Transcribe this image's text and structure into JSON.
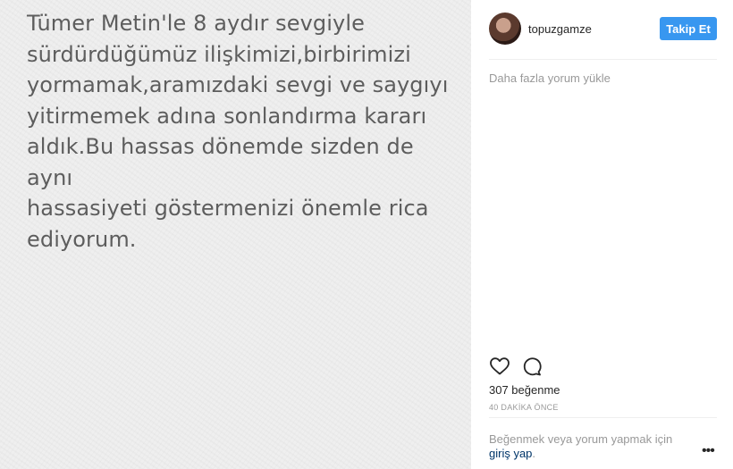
{
  "post": {
    "image_text": "Tümer Metin'le 8 aydır sevgiyle\nsürdürdüğümüz ilişkimizi,birbirimizi\nyormamak,aramızdaki sevgi ve saygıyı\nyitirmemek adına sonlandırma kararı\naldık.Bu hassas dönemde sizden de aynı\nhassasiyeti göstermenizi önemle rica\nediyorum."
  },
  "header": {
    "username": "topuzgamze",
    "follow_label": "Takip Et"
  },
  "comments": {
    "load_more_label": "Daha fazla yorum yükle"
  },
  "actions": {
    "like_icon": "heart-outline",
    "comment_icon": "speech-bubble-outline"
  },
  "stats": {
    "likes": "307 beğenme",
    "timestamp": "40 DAKİKA ÖNCE"
  },
  "footer": {
    "prompt": "Beğenmek veya yorum yapmak için",
    "login_link": "giriş yap",
    "prompt_end": ".",
    "more_label": "•••"
  },
  "colors": {
    "accent": "#3897f0",
    "link": "#003569",
    "muted": "#999999"
  }
}
